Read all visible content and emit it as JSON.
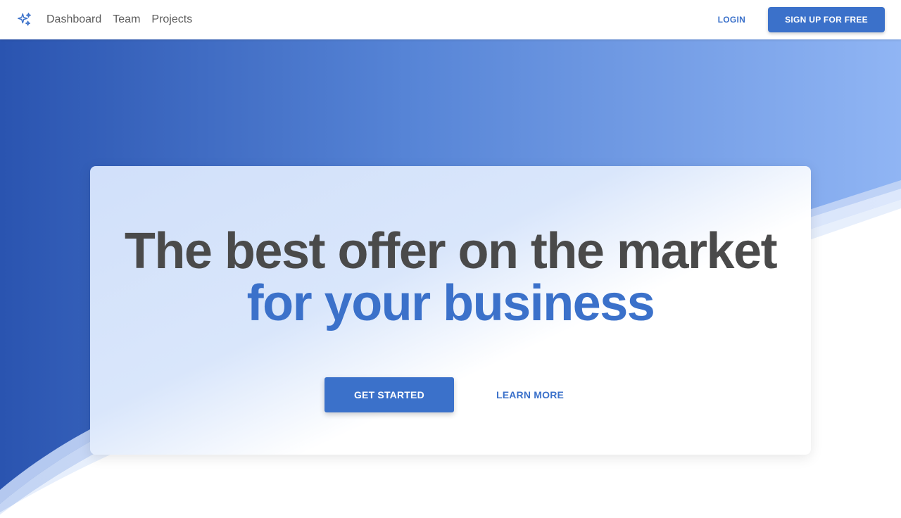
{
  "navbar": {
    "brand_icon": "sparkles-icon",
    "links": [
      {
        "label": "Dashboard"
      },
      {
        "label": "Team"
      },
      {
        "label": "Projects"
      }
    ],
    "login_label": "LOGIN",
    "signup_label": "SIGN UP FOR FREE"
  },
  "hero": {
    "title_line1": "The best offer on the market",
    "title_line2": "for your business",
    "primary_cta": "GET STARTED",
    "secondary_cta": "LEARN MORE"
  },
  "colors": {
    "accent": "#3b71ca",
    "title_dark": "#4a4a4a",
    "gradient_start": "#2a54b0",
    "gradient_end": "#8fb4f3"
  }
}
